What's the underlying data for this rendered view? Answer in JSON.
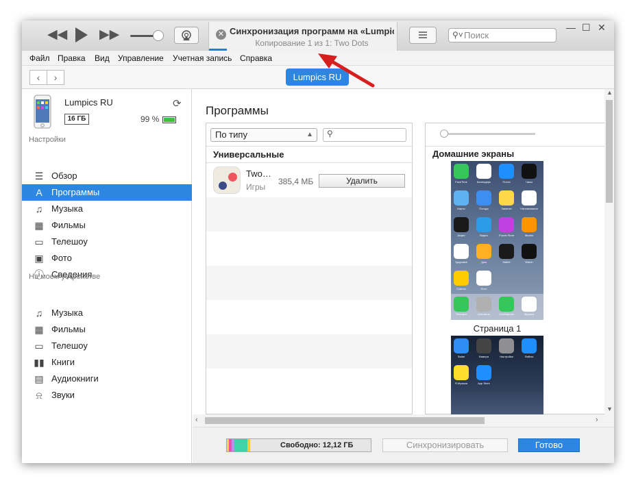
{
  "titlebar": {
    "now_playing_title": "Синхронизация программ на «Lumpics RU»",
    "now_playing_subtitle": "Копирование 1 из 1: Two Dots",
    "search_placeholder": "Поиск"
  },
  "menu": [
    "Файл",
    "Правка",
    "Вид",
    "Управление",
    "Учетная запись",
    "Справка"
  ],
  "device_button": "Lumpics RU",
  "device": {
    "name": "Lumpics RU",
    "capacity": "16 ГБ",
    "battery": "99 %"
  },
  "sidebar": {
    "section_settings": "Настройки",
    "settings_items": [
      {
        "label": "Обзор",
        "icon": "list-icon"
      },
      {
        "label": "Программы",
        "icon": "app-store-icon",
        "selected": true
      },
      {
        "label": "Музыка",
        "icon": "music-note-icon"
      },
      {
        "label": "Фильмы",
        "icon": "film-icon"
      },
      {
        "label": "Телешоу",
        "icon": "tv-icon"
      },
      {
        "label": "Фото",
        "icon": "camera-icon"
      },
      {
        "label": "Сведения",
        "icon": "info-icon"
      }
    ],
    "section_device": "На моем устройстве",
    "device_items": [
      {
        "label": "Музыка",
        "icon": "music-note-icon"
      },
      {
        "label": "Фильмы",
        "icon": "film-icon"
      },
      {
        "label": "Телешоу",
        "icon": "tv-icon"
      },
      {
        "label": "Книги",
        "icon": "book-icon"
      },
      {
        "label": "Аудиокниги",
        "icon": "audiobook-icon"
      },
      {
        "label": "Звуки",
        "icon": "bell-icon"
      }
    ]
  },
  "main": {
    "title": "Программы",
    "sort_value": "По типу",
    "apps_header": "Универсальные",
    "apps": [
      {
        "name": "Two…",
        "genre": "Игры",
        "size": "385,4 МБ",
        "action": "Удалить"
      }
    ],
    "home_header": "Домашние экраны",
    "page_label": "Страница 1"
  },
  "screen1_icons": [
    {
      "label": "FaceTime",
      "color": "#35c759"
    },
    {
      "label": "Календарь",
      "color": "#ffffff"
    },
    {
      "label": "Почта",
      "color": "#1f8fff"
    },
    {
      "label": "Часы",
      "color": "#111111"
    },
    {
      "label": "Карты",
      "color": "#5fb2f0"
    },
    {
      "label": "Погода",
      "color": "#3d8ef0"
    },
    {
      "label": "Заметки",
      "color": "#ffd84a"
    },
    {
      "label": "Напоминания",
      "color": "#ffffff"
    },
    {
      "label": "Акции",
      "color": "#1a1a1a"
    },
    {
      "label": "Видео",
      "color": "#2d9be8"
    },
    {
      "label": "iTunes Store",
      "color": "#c040e0"
    },
    {
      "label": "iBooks",
      "color": "#ff9400"
    },
    {
      "label": "Здоровье",
      "color": "#ffffff"
    },
    {
      "label": "Дом",
      "color": "#ffb020"
    },
    {
      "label": "Wallet",
      "color": "#1a1a1a"
    },
    {
      "label": "Watch",
      "color": "#111111"
    },
    {
      "label": "Советы",
      "color": "#ffcc00"
    },
    {
      "label": "Фото",
      "color": "#ffffff"
    }
  ],
  "screen1_dock": [
    {
      "label": "Телефон",
      "color": "#35c759"
    },
    {
      "label": "Контакты",
      "color": "#b0b0b0"
    },
    {
      "label": "Сообщения",
      "color": "#35c759"
    },
    {
      "label": "Музыка",
      "color": "#ffffff"
    }
  ],
  "screen2_icons": [
    {
      "label": "Safari",
      "color": "#2f8ef5"
    },
    {
      "label": "Камера",
      "color": "#444444"
    },
    {
      "label": "Настройки",
      "color": "#8e8e93"
    },
    {
      "label": "Файлы",
      "color": "#1f8fff"
    },
    {
      "label": "Я.Музыка",
      "color": "#ffdd2d"
    },
    {
      "label": "App Store",
      "color": "#1f8fff"
    }
  ],
  "bottom": {
    "free_label": "Свободно: 12,12 ГБ",
    "sync_label": "Синхронизировать",
    "done_label": "Готово"
  },
  "storage_segments": [
    {
      "color": "#f7d24a",
      "fraction": 0.012
    },
    {
      "color": "#e94fb6",
      "fraction": 0.02
    },
    {
      "color": "#c58bea",
      "fraction": 0.02
    },
    {
      "color": "#3ed4a8",
      "fraction": 0.09
    },
    {
      "color": "#f4cd37",
      "fraction": 0.02
    }
  ],
  "colors": {
    "accent": "#2d86e0",
    "arrow": "#d62020"
  }
}
